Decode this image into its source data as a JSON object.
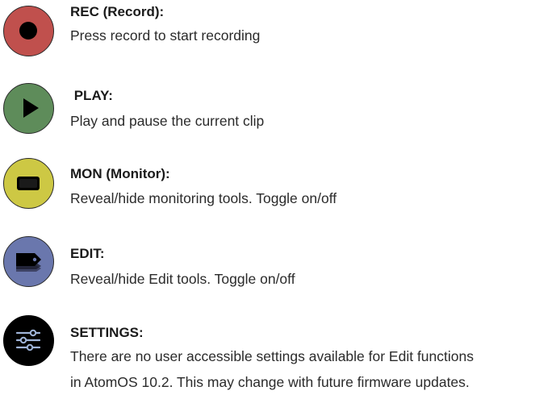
{
  "colors": {
    "rec": "#c0504d",
    "play": "#5e8c5a",
    "mon": "#cdc844",
    "edit": "#6a77ad",
    "settings": "#000000"
  },
  "items": [
    {
      "icon": "record-icon",
      "title": "REC (Record):",
      "description": "Press record to start recording"
    },
    {
      "icon": "play-icon",
      "title": " PLAY:",
      "description": "Play and pause the current clip"
    },
    {
      "icon": "monitor-icon",
      "title": "MON (Monitor):",
      "description": "Reveal/hide monitoring tools. Toggle on/off"
    },
    {
      "icon": "edit-tag-icon",
      "title": "EDIT:",
      "description": "Reveal/hide Edit tools. Toggle on/off"
    },
    {
      "icon": "sliders-icon",
      "title": "SETTINGS:",
      "description_lines": [
        "There are no user accessible settings available for Edit functions",
        "in AtomOS 10.2. This may change with future firmware updates."
      ]
    }
  ]
}
